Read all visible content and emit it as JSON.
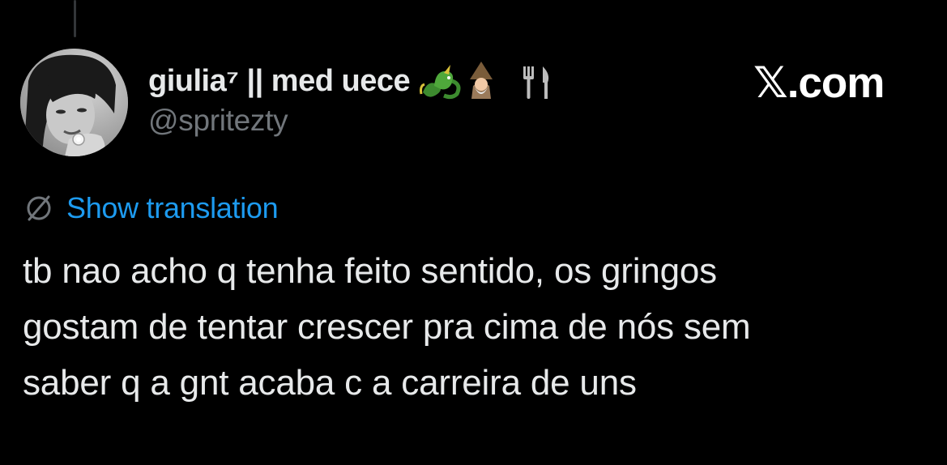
{
  "author": {
    "display_name": "giulia⁷ || med uece",
    "name_emojis": [
      "dragon-emoji",
      "mage-emoji",
      "fork-and-knife-icon"
    ],
    "handle": "@spritezty"
  },
  "brand": {
    "label": "𝕏.com"
  },
  "translation": {
    "label": "Show translation"
  },
  "tweet": {
    "lines": [
      "tb nao acho q tenha feito sentido, os gringos",
      "gostam de tentar crescer pra cima de nós sem",
      "saber q a gnt acaba c a carreira de uns"
    ]
  },
  "colors": {
    "background": "#000000",
    "text": "#e7e9ea",
    "muted": "#71767b",
    "accent": "#1d9bf0"
  }
}
